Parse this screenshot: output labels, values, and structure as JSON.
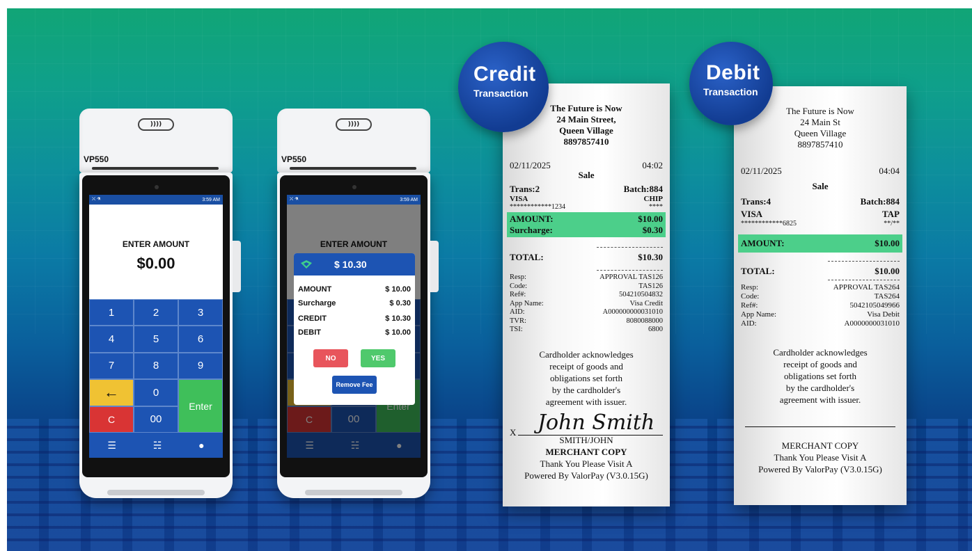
{
  "terminal_left": {
    "model": "VP550",
    "nfc_symbol": "))))",
    "status_time": "3:59 AM",
    "status_left": "⛌ ⚗",
    "screen_title": "ENTER AMOUNT",
    "amount": "$0.00",
    "keys": [
      "1",
      "2",
      "3",
      "4",
      "5",
      "6",
      "7",
      "8",
      "9",
      "←",
      "0",
      "C",
      "00"
    ],
    "enter_label": "Enter",
    "nav_icons": [
      "menu-icon",
      "cart-icon",
      "user-icon"
    ]
  },
  "terminal_right": {
    "model": "VP550",
    "nfc_symbol": "))))",
    "status_time": "3:59 AM",
    "status_left": "⛌ ⚗",
    "screen_title": "ENTER AMOUNT",
    "keys_visible": [
      "C",
      "00"
    ],
    "enter_label": "Enter",
    "dialog": {
      "total": "$ 10.30",
      "rows": [
        {
          "label": "AMOUNT",
          "value": "$ 10.00"
        },
        {
          "label": "Surcharge",
          "value": "$ 0.30"
        },
        {
          "label": "CREDIT",
          "value": "$ 10.30"
        },
        {
          "label": "DEBIT",
          "value": "$ 10.00"
        }
      ],
      "no_label": "NO",
      "yes_label": "YES",
      "remove_fee_label": "Remove Fee"
    }
  },
  "credit_receipt": {
    "badge_title": "Credit",
    "badge_sub": "Transaction",
    "header": [
      "The Future is Now",
      "24 Main Street,",
      "Queen Village",
      "8897857410"
    ],
    "date": "02/11/2025",
    "time": "04:02",
    "type": "Sale",
    "trans": "Trans:2",
    "batch": "Batch:884",
    "card": "VISA",
    "entry": "CHIP",
    "card_number": "************1234",
    "exp": "****",
    "amount_label": "AMOUNT:",
    "amount": "$10.00",
    "surcharge_label": "Surcharge:",
    "surcharge": "$0.30",
    "total_label": "TOTAL:",
    "total": "$10.30",
    "details": [
      {
        "label": "Resp:",
        "value": "APPROVAL TAS126"
      },
      {
        "label": "Code:",
        "value": "TAS126"
      },
      {
        "label": "Ref#:",
        "value": "504210504832"
      },
      {
        "label": "App Name:",
        "value": "Visa Credit"
      },
      {
        "label": "AID:",
        "value": "A000000000031010"
      },
      {
        "label": "TVR:",
        "value": "8080088000"
      },
      {
        "label": "TSI:",
        "value": "6800"
      }
    ],
    "acknowledgement": [
      "Cardholder acknowledges",
      "receipt of goods and",
      "obligations set forth",
      "by the cardholder's",
      "agreement with issuer."
    ],
    "x_mark": "X",
    "signature": "John Smith",
    "signer_name": "SMITH/JOHN",
    "copy_label": "MERCHANT COPY",
    "thanks": "Thank You Please Visit A",
    "powered": "Powered By ValorPay (V3.0.15G)"
  },
  "debit_receipt": {
    "badge_title": "Debit",
    "badge_sub": "Transaction",
    "header": [
      "The Future is Now",
      "24 Main St",
      "Queen Village",
      "8897857410"
    ],
    "date": "02/11/2025",
    "time": "04:04",
    "type": "Sale",
    "trans": "Trans:4",
    "batch": "Batch:884",
    "card": "VISA",
    "entry": "TAP",
    "card_number": "************6825",
    "exp": "**/**",
    "amount_label": "AMOUNT:",
    "amount": "$10.00",
    "total_label": "TOTAL:",
    "total": "$10.00",
    "details": [
      {
        "label": "Resp:",
        "value": "APPROVAL TAS264"
      },
      {
        "label": "Code:",
        "value": "TAS264"
      },
      {
        "label": "Ref#:",
        "value": "5042105049966"
      },
      {
        "label": "App Name:",
        "value": "Visa Debit"
      },
      {
        "label": "AID:",
        "value": "A0000000031010"
      }
    ],
    "acknowledgement": [
      "Cardholder acknowledges",
      "receipt of goods and",
      "obligations set forth",
      "by the cardholder's",
      "agreement with issuer."
    ],
    "copy_label": "MERCHANT COPY",
    "thanks": "Thank You Please Visit A",
    "powered": "Powered By ValorPay (V3.0.15G)"
  },
  "colors": {
    "brand_blue": "#1d54b3",
    "highlight_green": "#4ccf8a",
    "key_yellow": "#f0c233",
    "key_red": "#d93434",
    "key_green": "#3fbf5a"
  }
}
